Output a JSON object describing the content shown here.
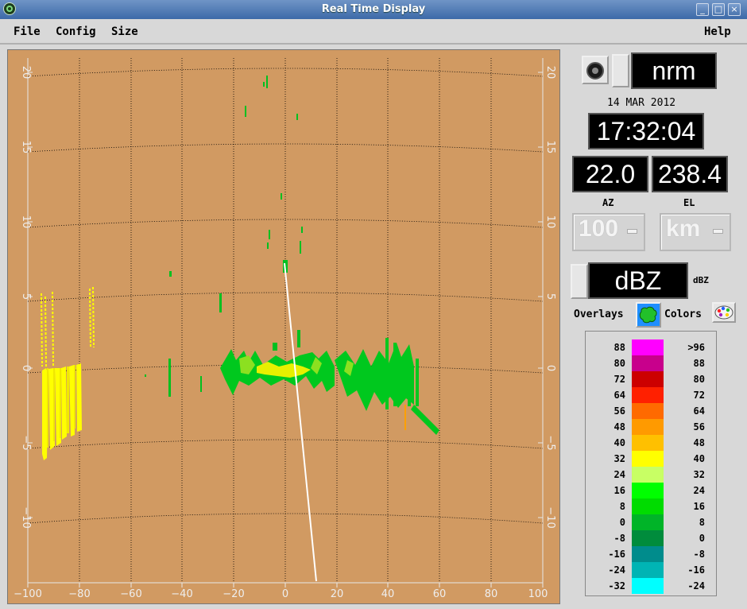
{
  "window": {
    "title": "Real Time Display",
    "buttons": [
      "_",
      "□",
      "×"
    ]
  },
  "menu": {
    "file": "File",
    "config": "Config",
    "size": "Size",
    "help": "Help"
  },
  "plot": {
    "x_ticks": [
      "−100",
      "−80",
      "−60",
      "−40",
      "−20",
      "0",
      "20",
      "40",
      "60",
      "80",
      "100"
    ],
    "y_ticks": [
      "20",
      "15",
      "10",
      "5",
      "0",
      "−5",
      "−10"
    ]
  },
  "controls": {
    "mode": "nrm",
    "date": "14 MAR 2012",
    "time": "17:32:04",
    "az_value": "22.0",
    "el_value": "238.4",
    "az_label": "AZ",
    "el_label": "EL",
    "range_value": "100",
    "unit_value": "km",
    "field_value": "dBZ",
    "field_unit": "dBZ",
    "overlays_label": "Overlays",
    "colors_label": "Colors"
  },
  "legend": [
    {
      "left": "88",
      "right": ">96",
      "color": "#ff00ff"
    },
    {
      "left": "80",
      "right": "88",
      "color": "#c8008c"
    },
    {
      "left": "72",
      "right": "80",
      "color": "#cc0000"
    },
    {
      "left": "64",
      "right": "72",
      "color": "#ff2000"
    },
    {
      "left": "56",
      "right": "64",
      "color": "#ff6a00"
    },
    {
      "left": "48",
      "right": "56",
      "color": "#ff9a00"
    },
    {
      "left": "40",
      "right": "48",
      "color": "#ffc000"
    },
    {
      "left": "32",
      "right": "40",
      "color": "#ffff00"
    },
    {
      "left": "24",
      "right": "32",
      "color": "#c8ff64"
    },
    {
      "left": "16",
      "right": "24",
      "color": "#00ff00"
    },
    {
      "left": "8",
      "right": "16",
      "color": "#00dc00"
    },
    {
      "left": "0",
      "right": "8",
      "color": "#00b428"
    },
    {
      "left": "-8",
      "right": "0",
      "color": "#008c3c"
    },
    {
      "left": "-16",
      "right": "-8",
      "color": "#008c8c"
    },
    {
      "left": "-24",
      "right": "-16",
      "color": "#00b4b4"
    },
    {
      "left": "-32",
      "right": "-24",
      "color": "#00ffff"
    }
  ]
}
